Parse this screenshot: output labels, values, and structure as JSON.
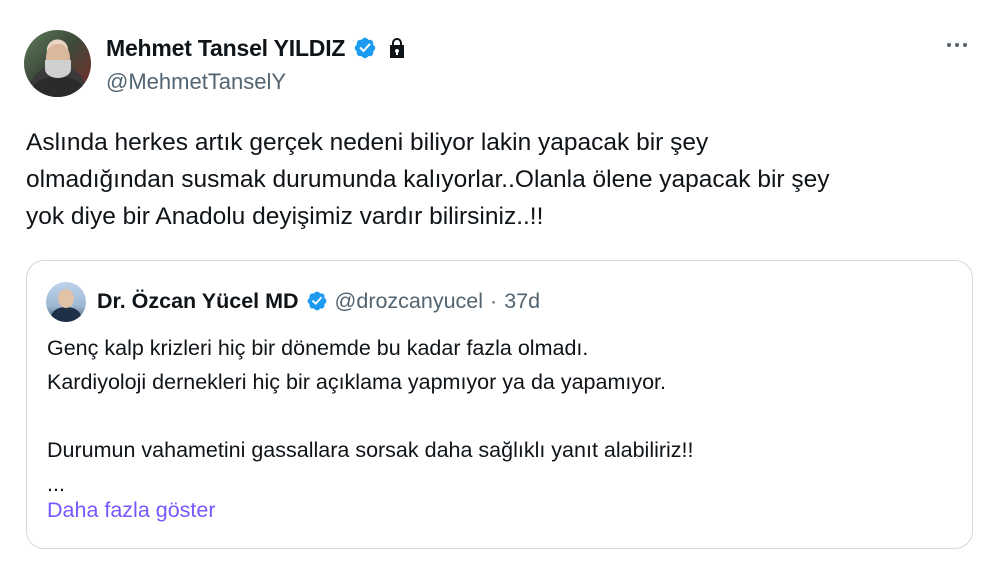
{
  "tweet": {
    "author": {
      "display_name": "Mehmet Tansel YILDIZ",
      "handle": "@MehmetTanselY",
      "verified_icon": "verified-badge-icon",
      "lock_icon": "lock-icon"
    },
    "text_lines": [
      "Aslında herkes artık gerçek nedeni biliyor lakin yapacak bir şey",
      "olmadığından susmak durumunda kalıyorlar..Olanla ölene yapacak bir şey",
      "yok diye bir Anadolu deyişimiz vardır bilirsiniz..!!"
    ],
    "more_icon": "more-options-icon"
  },
  "quote": {
    "author": {
      "display_name": "Dr. Özcan Yücel MD",
      "handle": "@drozcanyucel",
      "separator": "·",
      "time": "37d"
    },
    "text_lines": [
      "Genç kalp krizleri hiç bir dönemde bu kadar fazla olmadı.",
      "Kardiyoloji dernekleri hiç bir açıklama yapmıyor ya da yapamıyor.",
      "",
      "Durumun vahametini gassallara sorsak daha sağlıklı yanıt alabiliriz!!",
      "..."
    ],
    "show_more": "Daha fazla göster"
  },
  "colors": {
    "text": "#0f1419",
    "secondary": "#536471",
    "verified": "#1d9bf0",
    "link": "#7856ff",
    "border": "#cfd9de"
  }
}
